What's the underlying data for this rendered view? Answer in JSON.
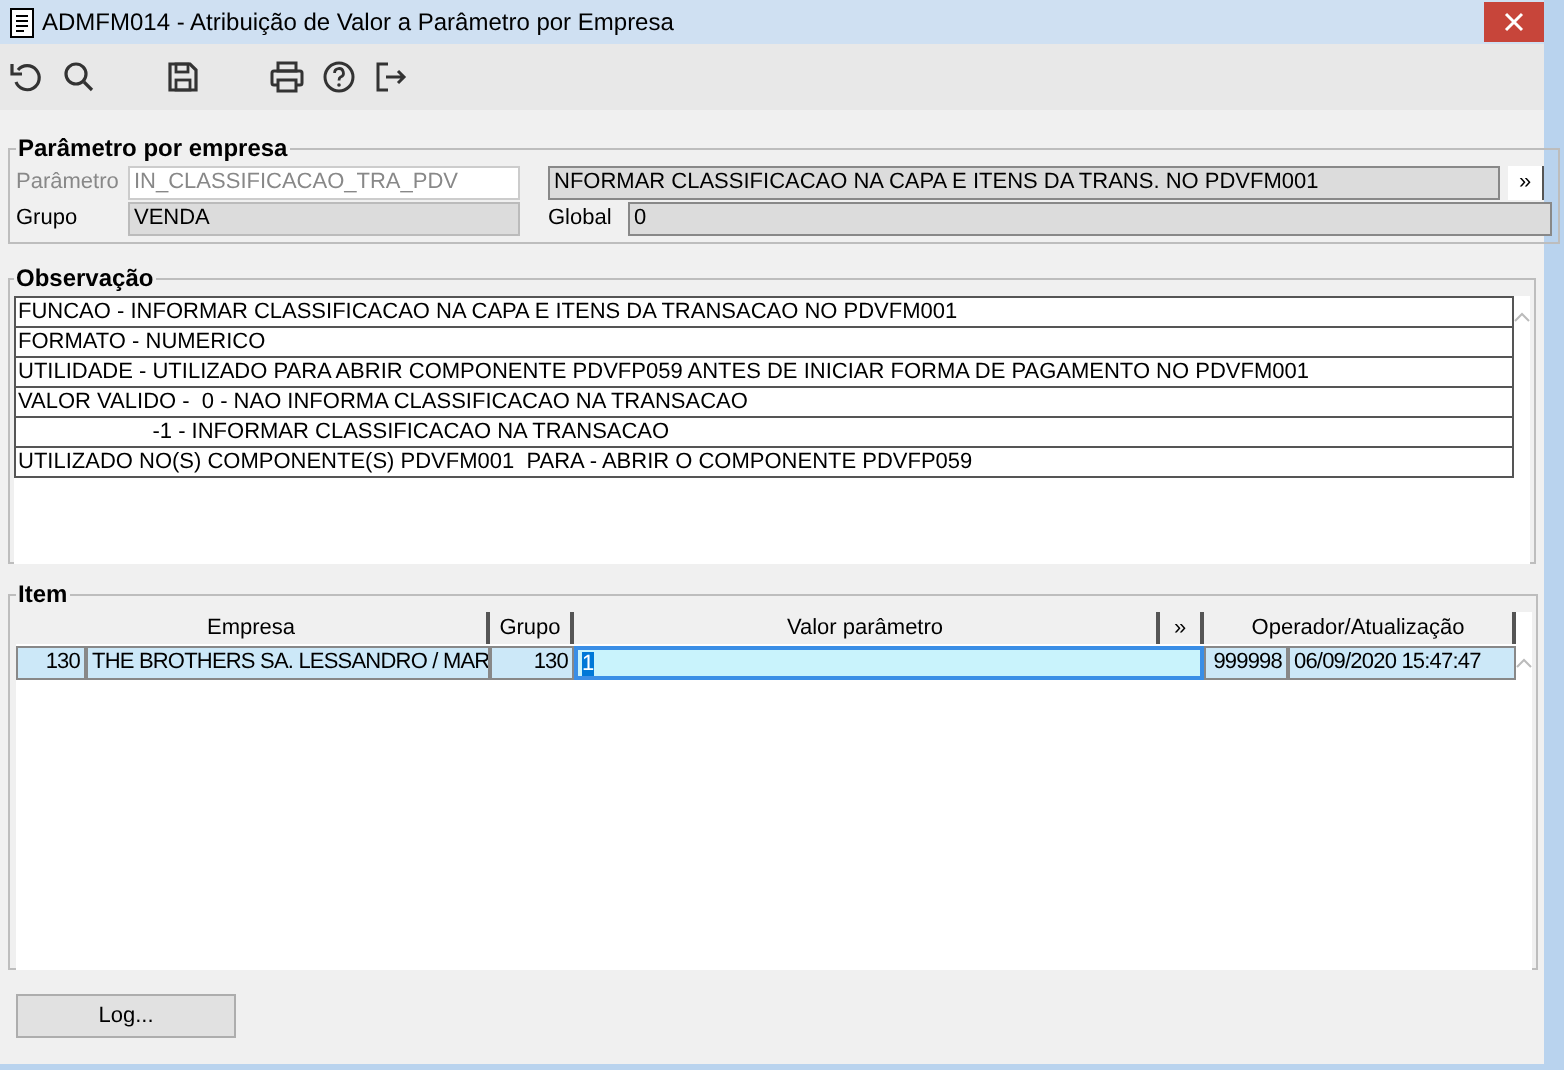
{
  "window": {
    "title": "ADMFM014 - Atribuição de Valor a Parâmetro por Empresa"
  },
  "toolbar": [
    {
      "kind": "undo"
    },
    {
      "kind": "search"
    },
    {
      "kind": "save"
    },
    {
      "kind": "print"
    },
    {
      "kind": "help"
    },
    {
      "kind": "exit"
    }
  ],
  "parametro_group": {
    "title": "Parâmetro por empresa",
    "parametro_label": "Parâmetro",
    "parametro_value": "IN_CLASSIFICACAO_TRA_PDV",
    "descricao": "NFORMAR CLASSIFICACAO NA CAPA E ITENS DA TRANS. NO PDVFM001",
    "more_button": "»",
    "grupo_label": "Grupo",
    "grupo_value": "VENDA",
    "global_label": "Global",
    "global_value": "0"
  },
  "observacao": {
    "title": "Observação",
    "lines": [
      "FUNCAO - INFORMAR CLASSIFICACAO NA CAPA E ITENS DA TRANSACAO NO PDVFM001",
      "FORMATO - NUMERICO",
      "UTILIDADE - UTILIZADO PARA ABRIR COMPONENTE PDVFP059 ANTES DE INICIAR FORMA DE PAGAMENTO NO PDVFM001",
      "VALOR VALIDO -  0 - NAO INFORMA CLASSIFICACAO NA TRANSACAO",
      "                      -1 - INFORMAR CLASSIFICACAO NA TRANSACAO",
      "UTILIZADO NO(S) COMPONENTE(S) PDVFM001  PARA - ABRIR O COMPONENTE PDVFP059"
    ]
  },
  "item": {
    "title": "Item",
    "columns": [
      "Empresa",
      "Grupo",
      "Valor parâmetro",
      "»",
      "Operador/Atualização"
    ],
    "rows": [
      {
        "selected": true,
        "empresa": [
          "130",
          "THE BROTHERS SA. LESSANDRO / MAR"
        ],
        "grupo": "130",
        "valor_parametro": "1",
        "operador_atualizacao": [
          "999998",
          "06/09/2020 15:47:47"
        ]
      }
    ]
  },
  "log_button": "Log..."
}
